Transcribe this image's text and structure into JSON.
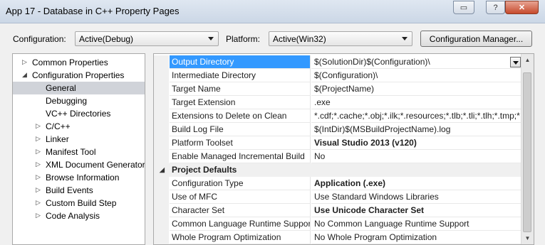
{
  "window": {
    "title": "App 17 - Database in C++ Property Pages",
    "buttons": {
      "restore": "▭",
      "help": "?",
      "close": "✕"
    }
  },
  "config": {
    "configuration_label": "Configuration:",
    "configuration_value": "Active(Debug)",
    "platform_label": "Platform:",
    "platform_value": "Active(Win32)",
    "manager_button": "Configuration Manager..."
  },
  "tree": {
    "items": [
      {
        "label": "Common Properties",
        "glyph": "▷"
      },
      {
        "label": "Configuration Properties",
        "glyph": "◢"
      },
      {
        "label": "General",
        "glyph": ""
      },
      {
        "label": "Debugging",
        "glyph": ""
      },
      {
        "label": "VC++ Directories",
        "glyph": ""
      },
      {
        "label": "C/C++",
        "glyph": "▷"
      },
      {
        "label": "Linker",
        "glyph": "▷"
      },
      {
        "label": "Manifest Tool",
        "glyph": "▷"
      },
      {
        "label": "XML Document Generator",
        "glyph": "▷"
      },
      {
        "label": "Browse Information",
        "glyph": "▷"
      },
      {
        "label": "Build Events",
        "glyph": "▷"
      },
      {
        "label": "Custom Build Step",
        "glyph": "▷"
      },
      {
        "label": "Code Analysis",
        "glyph": "▷"
      }
    ]
  },
  "grid": {
    "properties": [
      {
        "name": "Output Directory",
        "value": "$(SolutionDir)$(Configuration)\\"
      },
      {
        "name": "Intermediate Directory",
        "value": "$(Configuration)\\"
      },
      {
        "name": "Target Name",
        "value": "$(ProjectName)"
      },
      {
        "name": "Target Extension",
        "value": ".exe"
      },
      {
        "name": "Extensions to Delete on Clean",
        "value": "*.cdf;*.cache;*.obj;*.ilk;*.resources;*.tlb;*.tli;*.tlh;*.tmp;*"
      },
      {
        "name": "Build Log File",
        "value": "$(IntDir)$(MSBuildProjectName).log"
      },
      {
        "name": "Platform Toolset",
        "value": "Visual Studio 2013 (v120)"
      },
      {
        "name": "Enable Managed Incremental Build",
        "value": "No"
      }
    ],
    "category": {
      "label": "Project Defaults",
      "glyph": "◢"
    },
    "defaults": [
      {
        "name": "Configuration Type",
        "value": "Application (.exe)"
      },
      {
        "name": "Use of MFC",
        "value": "Use Standard Windows Libraries"
      },
      {
        "name": "Character Set",
        "value": "Use Unicode Character Set"
      },
      {
        "name": "Common Language Runtime Support",
        "value": "No Common Language Runtime Support"
      },
      {
        "name": "Whole Program Optimization",
        "value": "No Whole Program Optimization"
      }
    ],
    "scroll": {
      "up": "▲",
      "down": "▼"
    }
  },
  "colors": {
    "selection": "#3399ff",
    "tree_selected": "#d0d3d9"
  }
}
